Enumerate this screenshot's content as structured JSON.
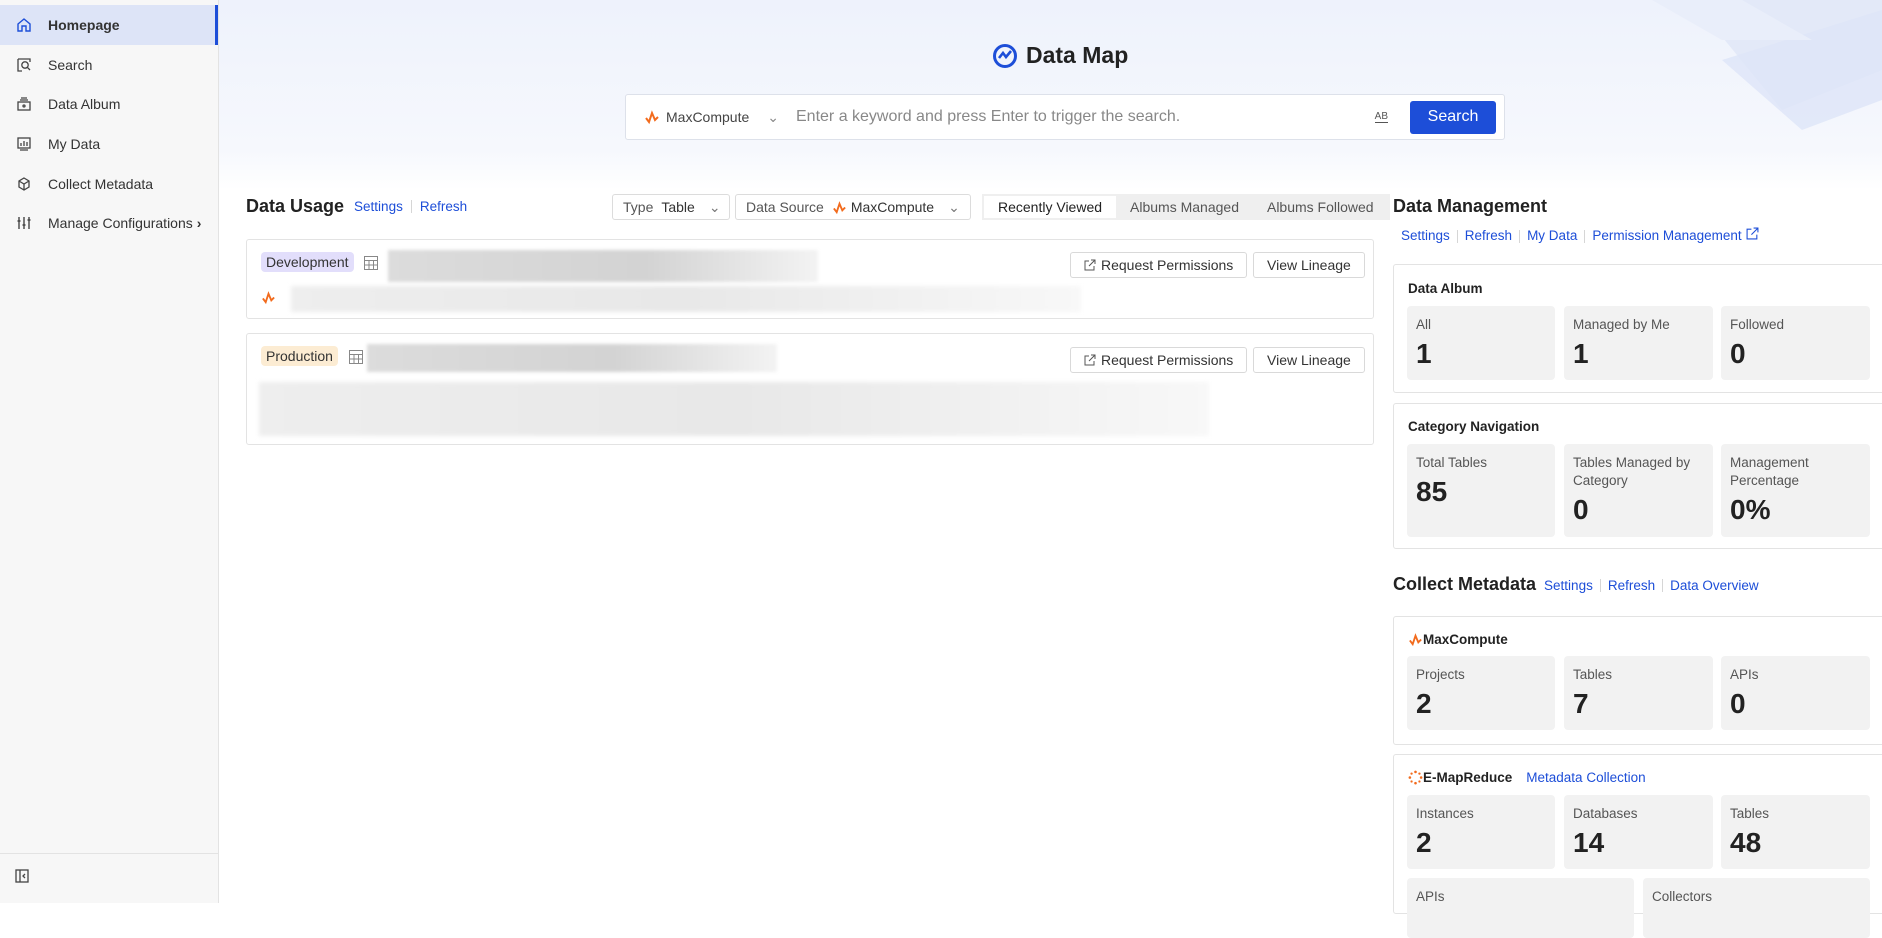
{
  "sidebar": {
    "items": [
      {
        "label": "Homepage",
        "icon": "home-icon"
      },
      {
        "label": "Search",
        "icon": "search-icon"
      },
      {
        "label": "Data Album",
        "icon": "album-icon"
      },
      {
        "label": "My Data",
        "icon": "chart-icon"
      },
      {
        "label": "Collect Metadata",
        "icon": "cube-icon"
      },
      {
        "label": "Manage Configurations",
        "icon": "sliders-icon"
      }
    ]
  },
  "header": {
    "title": "Data Map",
    "search": {
      "source": "MaxCompute",
      "placeholder": "Enter a keyword and press Enter to trigger the search.",
      "value": "",
      "case_label": "AB",
      "button": "Search"
    }
  },
  "data_usage": {
    "title": "Data Usage",
    "settings": "Settings",
    "refresh": "Refresh",
    "type_label": "Type",
    "type_value": "Table",
    "source_label": "Data Source",
    "source_value": "MaxCompute",
    "tabs": [
      "Recently Viewed",
      "Albums Managed",
      "Albums Followed"
    ],
    "items": [
      {
        "env": "Development",
        "request": "Request Permissions",
        "lineage": "View Lineage"
      },
      {
        "env": "Production",
        "request": "Request Permissions",
        "lineage": "View Lineage"
      }
    ]
  },
  "data_management": {
    "title": "Data Management",
    "links": [
      "Settings",
      "Refresh",
      "My Data",
      "Permission Management"
    ],
    "album": {
      "title": "Data Album",
      "stats": [
        {
          "label": "All",
          "value": "1"
        },
        {
          "label": "Managed by Me",
          "value": "1"
        },
        {
          "label": "Followed",
          "value": "0"
        }
      ]
    },
    "category": {
      "title": "Category Navigation",
      "stats": [
        {
          "label": "Total Tables",
          "value": "85"
        },
        {
          "label": "Tables Managed by Category",
          "value": "0"
        },
        {
          "label": "Management Percentage",
          "value": "0%"
        }
      ]
    }
  },
  "collect": {
    "title": "Collect Metadata",
    "links": [
      "Settings",
      "Refresh",
      "Data Overview"
    ],
    "maxcompute": {
      "title": "MaxCompute",
      "stats": [
        {
          "label": "Projects",
          "value": "2"
        },
        {
          "label": "Tables",
          "value": "7"
        },
        {
          "label": "APIs",
          "value": "0"
        }
      ]
    },
    "emr": {
      "title": "E-MapReduce",
      "link": "Metadata Collection",
      "stats": [
        {
          "label": "Instances",
          "value": "2"
        },
        {
          "label": "Databases",
          "value": "14"
        },
        {
          "label": "Tables",
          "value": "48"
        },
        {
          "label": "APIs",
          "value": ""
        },
        {
          "label": "Collectors",
          "value": ""
        }
      ]
    }
  },
  "colors": {
    "accent": "#1d4ed8",
    "maxcompute": "#f26b1d"
  }
}
